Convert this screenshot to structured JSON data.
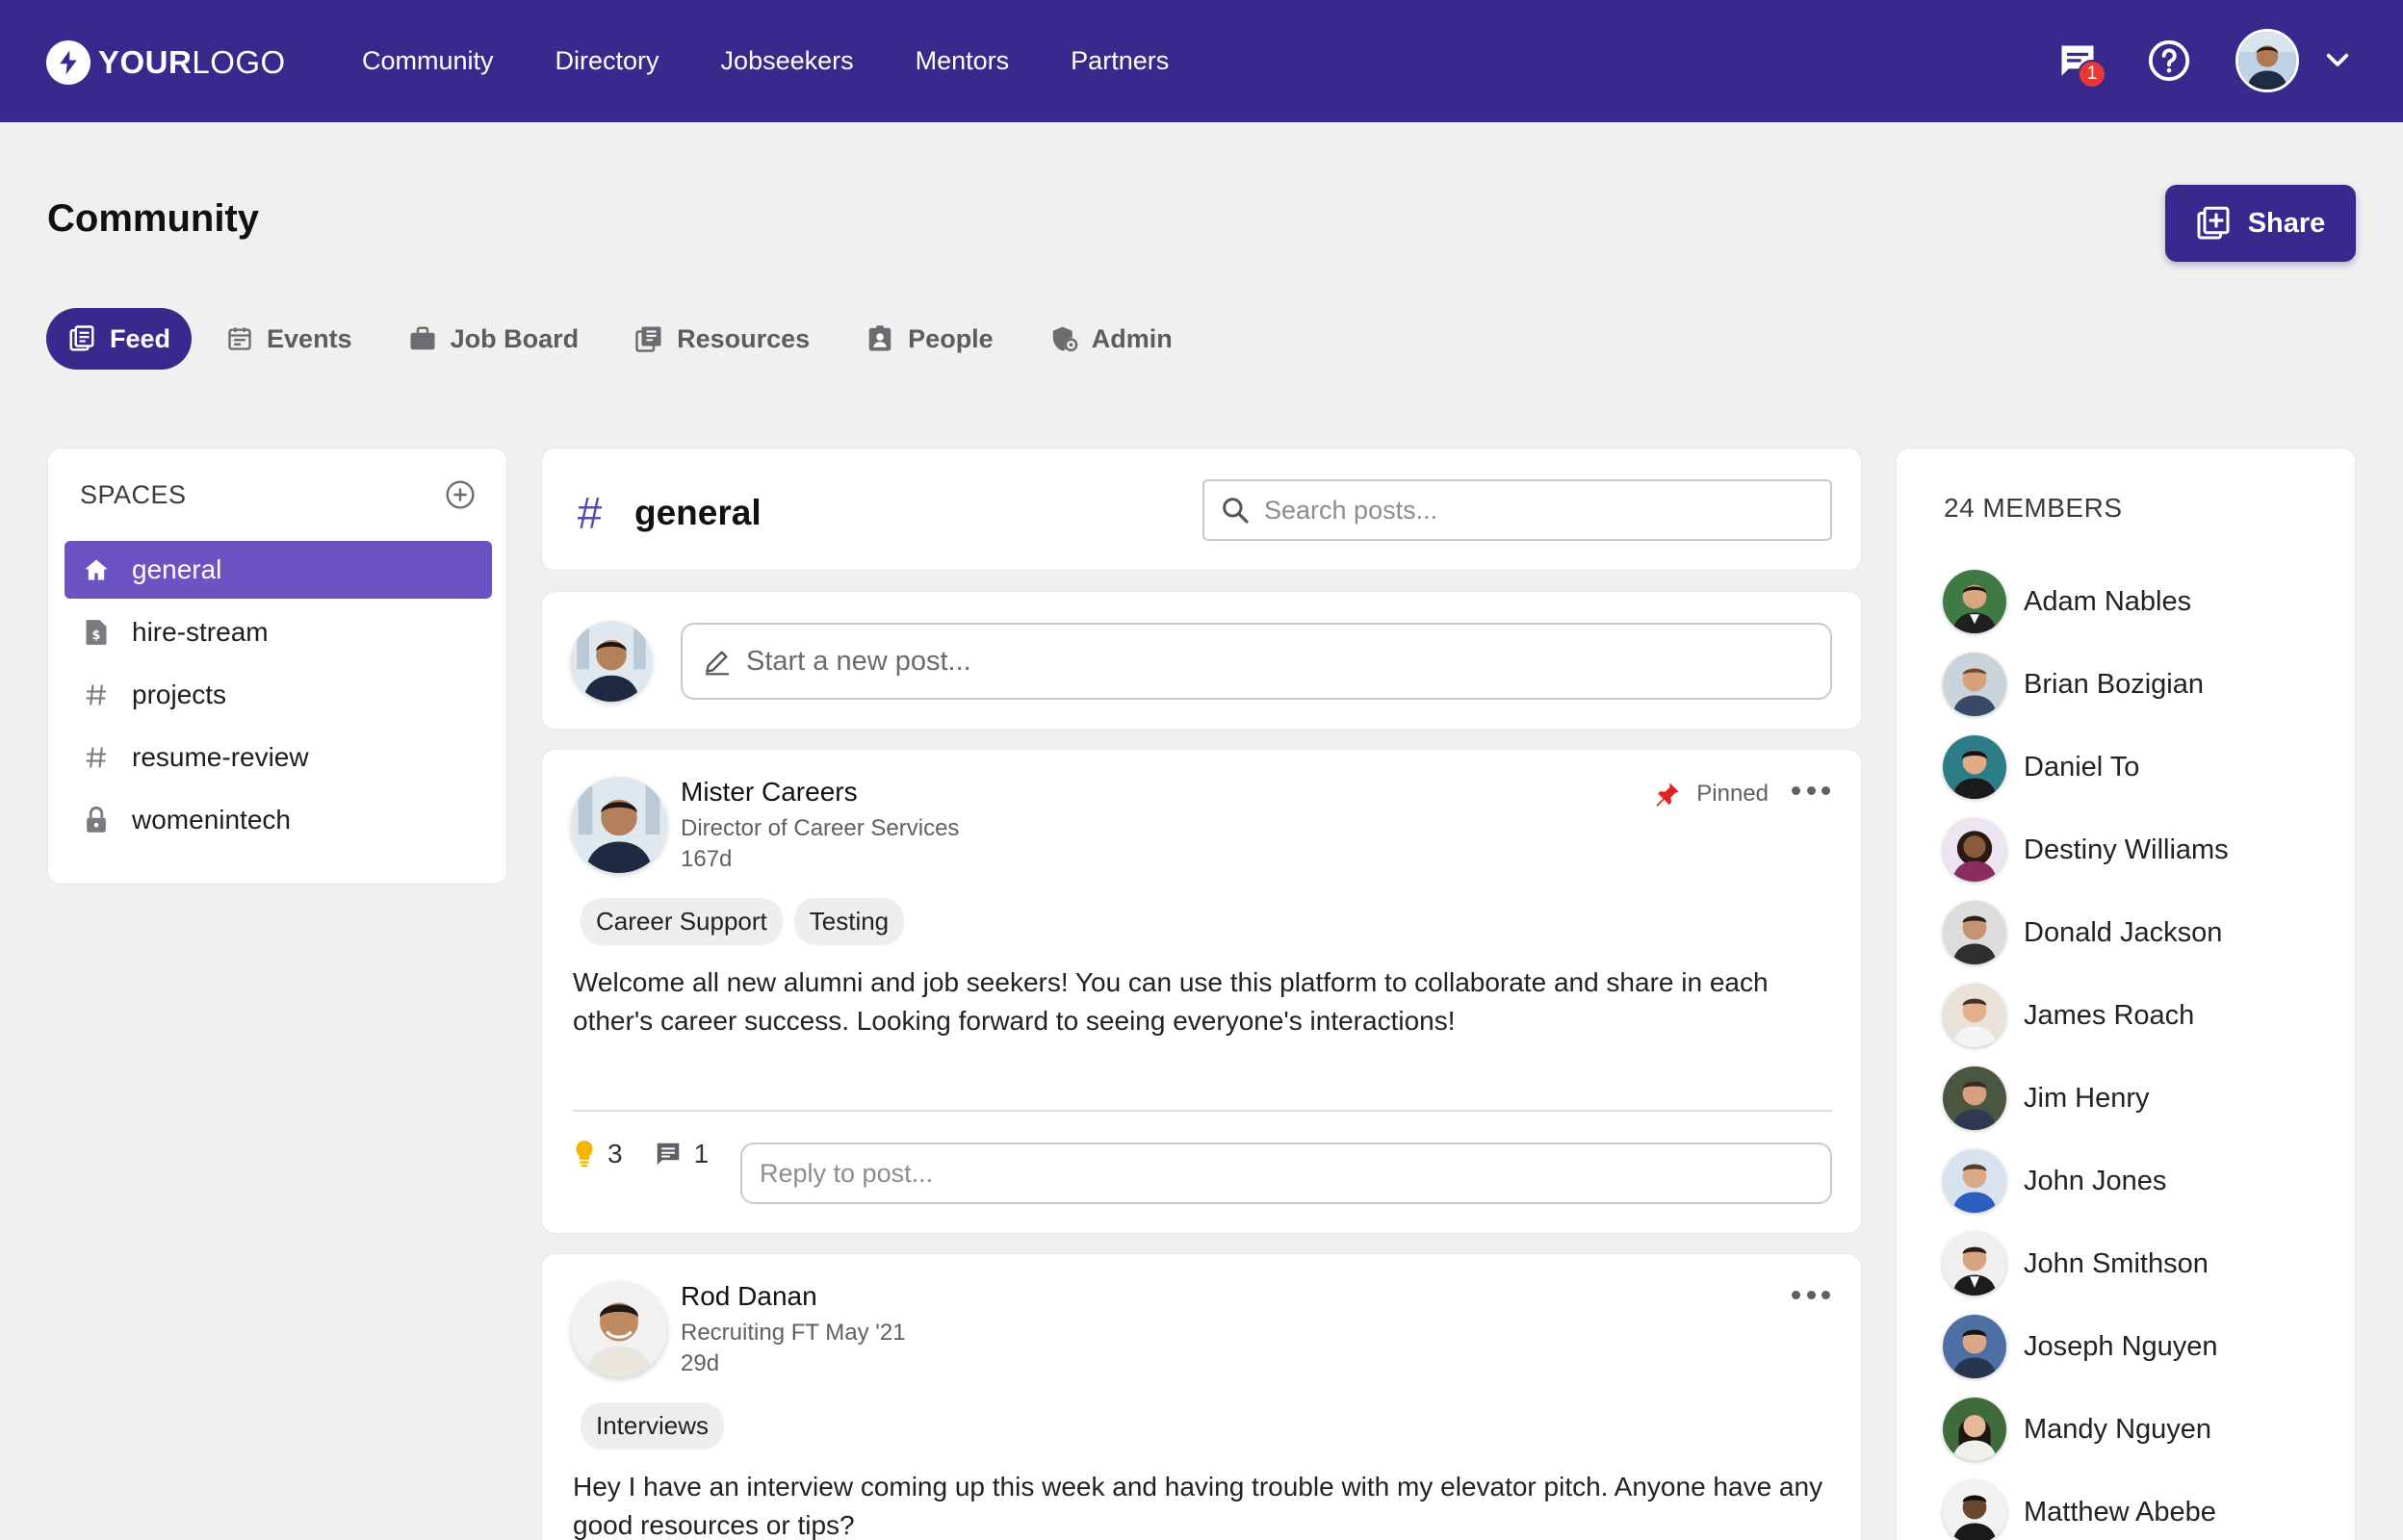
{
  "brand": {
    "logo_bold": "YOUR",
    "logo_light": "LOGO",
    "accent": "#38298c",
    "accent_light": "#6a54c4"
  },
  "nav": {
    "items": [
      {
        "label": "Community"
      },
      {
        "label": "Directory"
      },
      {
        "label": "Jobseekers"
      },
      {
        "label": "Mentors"
      },
      {
        "label": "Partners"
      }
    ],
    "chat_icon": "chat-icon",
    "notification_count": "1",
    "help_icon": "help-icon",
    "user_menu_icon": "chevron-down-icon"
  },
  "page": {
    "title": "Community",
    "share_label": "Share"
  },
  "tabs": [
    {
      "label": "Feed",
      "icon": "feed-icon",
      "active": true
    },
    {
      "label": "Events",
      "icon": "calendar-icon"
    },
    {
      "label": "Job Board",
      "icon": "briefcase-icon"
    },
    {
      "label": "Resources",
      "icon": "library-icon"
    },
    {
      "label": "People",
      "icon": "badge-icon"
    },
    {
      "label": "Admin",
      "icon": "admin-icon"
    }
  ],
  "spaces": {
    "heading": "SPACES",
    "items": [
      {
        "label": "general",
        "icon": "home-icon",
        "active": true
      },
      {
        "label": "hire-stream",
        "icon": "dollar-doc-icon"
      },
      {
        "label": "projects",
        "icon": "hash-icon"
      },
      {
        "label": "resume-review",
        "icon": "hash-icon"
      },
      {
        "label": "womenintech",
        "icon": "lock-icon"
      }
    ]
  },
  "channel": {
    "hash": "#",
    "name": "general",
    "search_placeholder": "Search posts..."
  },
  "composer": {
    "placeholder": "Start a new post..."
  },
  "posts": [
    {
      "author": "Mister Careers",
      "role": "Director of Career Services",
      "age": "167d",
      "pinned_label": "Pinned",
      "tags": [
        "Career Support",
        "Testing"
      ],
      "body": "Welcome all new alumni and job seekers! You can use this platform to collaborate and share in each other's career success. Looking forward to seeing everyone's interactions!",
      "likes": "3",
      "comments": "1",
      "reply_placeholder": "Reply to post..."
    },
    {
      "author": "Rod Danan",
      "role": "Recruiting FT May '21",
      "age": "29d",
      "tags": [
        "Interviews"
      ],
      "body": "Hey I have an interview coming up this week and having trouble with my elevator pitch. Anyone have any good resources or tips?"
    }
  ],
  "members": {
    "heading": "24 MEMBERS",
    "list": [
      {
        "name": "Adam Nables"
      },
      {
        "name": "Brian Bozigian"
      },
      {
        "name": "Daniel To"
      },
      {
        "name": "Destiny Williams"
      },
      {
        "name": "Donald Jackson"
      },
      {
        "name": "James Roach"
      },
      {
        "name": "Jim Henry"
      },
      {
        "name": "John Jones"
      },
      {
        "name": "John Smithson"
      },
      {
        "name": "Joseph Nguyen"
      },
      {
        "name": "Mandy Nguyen"
      },
      {
        "name": "Matthew Abebe"
      }
    ]
  }
}
